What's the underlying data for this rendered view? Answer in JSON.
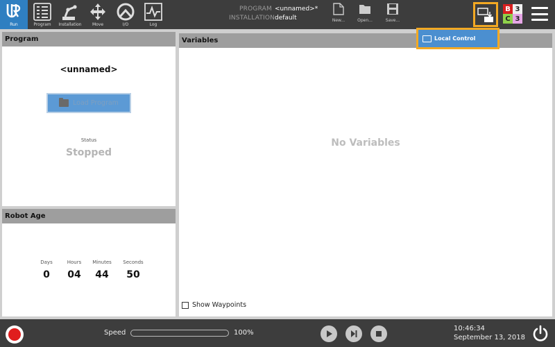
{
  "nav": {
    "items": [
      {
        "label": "Run",
        "icon": "ur-logo-icon",
        "active": true
      },
      {
        "label": "Program",
        "icon": "program-icon"
      },
      {
        "label": "Installation",
        "icon": "installation-icon"
      },
      {
        "label": "Move",
        "icon": "move-icon"
      },
      {
        "label": "I/O",
        "icon": "io-icon"
      },
      {
        "label": "Log",
        "icon": "log-icon"
      }
    ]
  },
  "program_info": {
    "program_key": "PROGRAM",
    "program_value": "<unnamed>*",
    "installation_key": "INSTALLATION",
    "installation_value": "default"
  },
  "file_actions": {
    "new_label": "New...",
    "open_label": "Open...",
    "save_label": "Save..."
  },
  "status_grid": {
    "b": "B",
    "b_count": "3",
    "c": "C",
    "c_count": "3",
    "colors": {
      "b": "#d81f1f",
      "c": "#8fd14a",
      "c_count": "#e6a6e6"
    }
  },
  "local_control": {
    "label": "Local Control",
    "highlight": "#f3a923"
  },
  "program_panel": {
    "title": "Program",
    "program_name": "<unnamed>",
    "load_button": "Load Program",
    "status_label": "Status",
    "status_value": "Stopped"
  },
  "robot_age": {
    "title": "Robot Age",
    "columns": [
      {
        "label": "Days",
        "value": "0"
      },
      {
        "label": "Hours",
        "value": "04"
      },
      {
        "label": "Minutes",
        "value": "44"
      },
      {
        "label": "Seconds",
        "value": "50"
      }
    ]
  },
  "variables": {
    "title": "Variables",
    "empty_text": "No Variables",
    "show_waypoints_label": "Show Waypoints",
    "show_waypoints_checked": false
  },
  "bottom": {
    "speed_label": "Speed",
    "speed_value": "100%",
    "speed_fraction": 1.0,
    "time": "10:46:34",
    "date": "September 13, 2018"
  },
  "colors": {
    "accent": "#2f7fc1",
    "bar": "#3d3d3d",
    "record": "#e01d1d"
  }
}
